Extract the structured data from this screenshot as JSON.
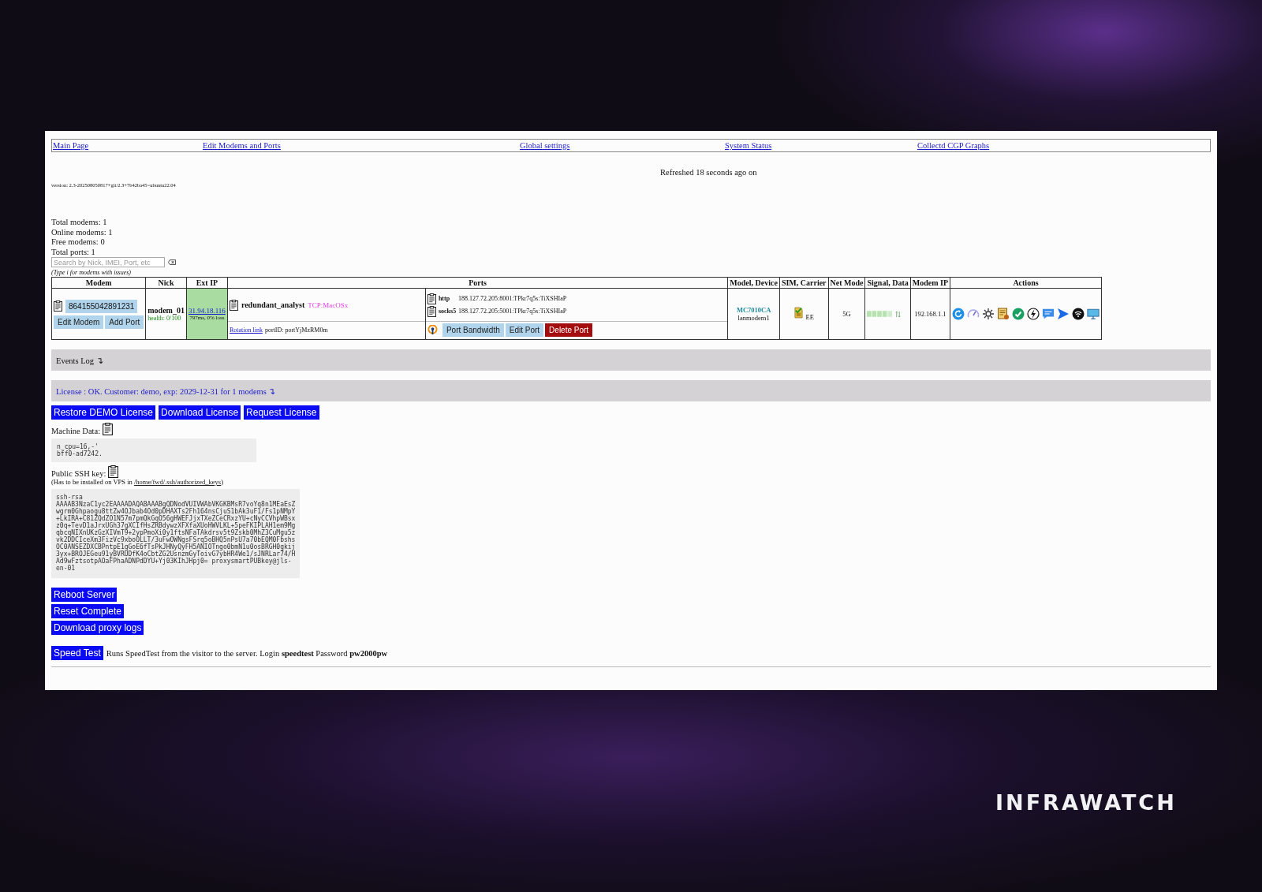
{
  "nav": [
    {
      "label": "Main Page"
    },
    {
      "label": "Edit Modems and Ports"
    },
    {
      "label": "Global settings"
    },
    {
      "label": "System Status"
    },
    {
      "label": "Collectd CGP Graphs"
    }
  ],
  "refreshed": "Refreshed 18 seconds ago on",
  "version": "version: 2.3-202508050817+git/2.3+7b42ba45~ubuntu22.04",
  "stats": [
    "Total modems: 1",
    "Online modems: 1",
    "Free modems: 0",
    "Total ports: 1"
  ],
  "search": {
    "placeholder": "Search by Nick, IMEI, Port, etc"
  },
  "search_hint": "(Type i for modems with issues)",
  "table": {
    "columns": [
      "Modem",
      "Nick",
      "Ext IP",
      "Ports",
      "Model, Device",
      "SIM, Carrier",
      "Net Mode",
      "Signal, Data",
      "Modem IP",
      "Actions"
    ],
    "rows": [
      {
        "imei": "864155042891231",
        "modem_buttons": [
          "Edit Modem",
          "Add Port"
        ],
        "nick": "modem_01",
        "health": "health: 0/100",
        "ext_ip": "31.94.18.116",
        "ext_ip_stats": "797ms, 0% loss",
        "port_name": "redundant_analyst",
        "port_tag": "TCP:MacOSx",
        "rotation_link": "Rotation link",
        "port_id": "portID: portYjMzRM0m",
        "ports": [
          {
            "proto": "http",
            "address": "188.127.72.205:8001:TPkr7q5s:TiXSHIaP"
          },
          {
            "proto": "socks5",
            "address": "188.127.72.205:5001:TPkr7q5s:TiXSHIaP"
          }
        ],
        "port_buttons": [
          {
            "label": "Port Bandwidth",
            "kind": "normal"
          },
          {
            "label": "Edit Port",
            "kind": "normal"
          },
          {
            "label": "Delete Port",
            "kind": "danger"
          }
        ],
        "model": "MC7010CA",
        "device": "lanmodem1",
        "carrier": "EE",
        "net_mode": "5G",
        "modem_ip": "192.168.1.1"
      }
    ]
  },
  "events_log": "Events Log ↴",
  "license": "License : OK. Customer: demo, exp: 2029-12-31 for 1 modems ↴",
  "license_buttons": [
    "Restore DEMO License",
    "Download License",
    "Request License"
  ],
  "machine_data": {
    "label": "Machine Data:",
    "value": "n_cpu=16,-'\nbff0-ad7242."
  },
  "ssh": {
    "label": "Public SSH key:",
    "note_prefix": "(Has to be installed on VPS in ",
    "note_path": "/home/fwd/.ssh/authorized_keys",
    "note_suffix": ")",
    "value": "ssh-rsa\nAAAAB3NzaC1yc2EAAAADAQABAAABgQDNodVUIVWAbVKGKBMsR7voYq8n1MEaEsZ\nwgrm0Ghpaogu8ttZw4OJbab4Od0pDHAXTs2Fh164nsCjuS1bAk3uF1/Fs1pNMpY\n+LkIRA+C81ZQdZO1N57m7pmQkGqO56gHWEFJjxTXeZCeCRxzYU+cNyCCVhpWBsx\nz0q+TevD1aJrxUGh37gXCIfHsZRBdywzXFXfaXUoHWVLKL+5peFKIPLAH1em9Mg\nqbcqNIXnUKzGzXIVmT9+2ypPmoXi0y1ftsNFaTAkdrsv5t9Zskb0MhZ3CuMgu5z\nvk2DDCIceXm3FizVc9xboOLLT/3uFwOWNgsFSrq5oBHQ5nPsU7a70bEQM0Fbshs\nOC0ANSEZDXCBPntpE1gGoE6fTsPkJHNyQyFH5ANIOTngo0bmN1u0osBRGH0gkij\n3yx+BROJEGeu91yBVRUDfK4oCbtZG2UsnzmGyToivG7ybHR4We1/sJNRLar74/H\nAd9wFztsotpAOaFPhaADNPdDYU+Yj03KIhJHpj0= proxysmartPUBkey@jls-\nen-01"
  },
  "server_buttons": [
    "Reboot Server",
    "Reset Complete",
    "Download proxy logs"
  ],
  "speed_test": {
    "button": "Speed Test",
    "text": "Runs SpeedTest from the visitor to the server. Login **speedtest** Password **pw2000pw**"
  },
  "brand": "INFRAWATCH"
}
